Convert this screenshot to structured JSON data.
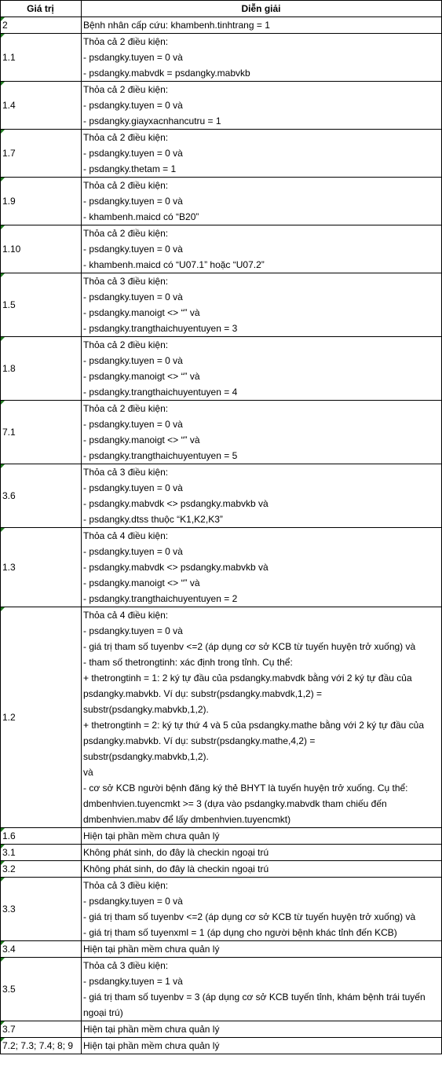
{
  "header": {
    "col1": "Giá trị",
    "col2": "Diễn giải"
  },
  "rows": [
    {
      "value": "2",
      "lines": [
        "Bệnh nhân cấp cứu: khambenh.tinhtrang = 1"
      ]
    },
    {
      "value": "1.1",
      "lines": [
        "Thỏa cả 2 điều kiện:",
        "- psdangky.tuyen = 0 và",
        "- psdangky.mabvdk = psdangky.mabvkb"
      ]
    },
    {
      "value": "1.4",
      "lines": [
        "Thỏa cả 2 điều kiện:",
        "- psdangky.tuyen = 0 và",
        "- psdangky.giayxacnhancutru = 1"
      ]
    },
    {
      "value": "1.7",
      "lines": [
        "Thỏa cả 2 điều kiện:",
        "- psdangky.tuyen = 0 và",
        "- psdangky.thetam = 1"
      ]
    },
    {
      "value": "1.9",
      "lines": [
        "Thỏa cả 2 điều kiện:",
        "- psdangky.tuyen = 0 và",
        "- khambenh.maicd có “B20”"
      ]
    },
    {
      "value": "1.10",
      "lines": [
        "Thỏa cả 2 điều kiện:",
        "- psdangky.tuyen = 0 và",
        "- khambenh.maicd có “U07.1” hoặc “U07.2”"
      ]
    },
    {
      "value": "1.5",
      "lines": [
        "Thỏa cả 3 điều kiện:",
        "- psdangky.tuyen = 0 và",
        "- psdangky.manoigt <> “” và",
        "- psdangky.trangthaichuyentuyen = 3"
      ]
    },
    {
      "value": "1.8",
      "lines": [
        "Thỏa cả 2 điều kiện:",
        "- psdangky.tuyen = 0 và",
        "- psdangky.manoigt <> “” và",
        "- psdangky.trangthaichuyentuyen = 4"
      ]
    },
    {
      "value": "7.1",
      "lines": [
        "Thỏa cả 2 điều kiện:",
        "- psdangky.tuyen = 0 và",
        "- psdangky.manoigt <> “” và",
        "- psdangky.trangthaichuyentuyen = 5"
      ]
    },
    {
      "value": "3.6",
      "lines": [
        "Thỏa cả 3 điều kiện:",
        "- psdangky.tuyen = 0 và",
        "- psdangky.mabvdk <> psdangky.mabvkb và",
        "- psdangky.dtss thuộc “K1,K2,K3”"
      ]
    },
    {
      "value": "1.3",
      "lines": [
        "Thỏa cả 4 điều kiện:",
        "- psdangky.tuyen = 0 và",
        "- psdangky.mabvdk <> psdangky.mabvkb và",
        "- psdangky.manoigt <> “” và",
        "- psdangky.trangthaichuyentuyen = 2"
      ]
    },
    {
      "value": "1.2",
      "lines": [
        "Thỏa cả 4 điều kiện:",
        "- psdangky.tuyen = 0 và",
        "- giá trị tham số tuyenbv <=2 (áp dụng cơ sở KCB từ tuyến huyện trở xuống) và",
        "- tham số thetrongtinh: xác định trong tỉnh. Cụ thể:",
        "+ thetrongtinh = 1: 2 ký tự đầu của  psdangky.mabvdk bằng với 2 ký tự đầu của psdangky.mabvkb. Ví dụ: substr(psdangky.mabvdk,1,2) = substr(psdangky.mabvkb,1,2).",
        "+ thetrongtinh = 2: ký tự thứ 4 và 5 của psdangky.mathe bằng với 2 ký tự đầu của  psdangky.mabvkb. Ví dụ: substr(psdangky.mathe,4,2) = substr(psdangky.mabvkb,1,2).",
        "và",
        "- cơ sở KCB người bệnh đăng ký thẻ BHYT là tuyến huyện trở xuống. Cụ thể: dmbenhvien.tuyencmkt >= 3 (dựa vào psdangky.mabvdk tham chiếu đến dmbenhvien.mabv để lấy dmbenhvien.tuyencmkt)"
      ]
    },
    {
      "value": "1.6",
      "lines": [
        "Hiện tại phần mềm chưa quản lý"
      ]
    },
    {
      "value": "3.1",
      "lines": [
        "Không phát sinh, do đây là checkin ngoại trú"
      ]
    },
    {
      "value": "3.2",
      "lines": [
        "Không phát sinh, do đây là checkin ngoại trú"
      ]
    },
    {
      "value": "3.3",
      "lines": [
        "Thỏa cả 3 điều kiện:",
        "- psdangky.tuyen = 0 và",
        "- giá trị tham số tuyenbv <=2 (áp dụng cơ sở KCB từ tuyến huyện trở xuống) và",
        "- giá trị tham số tuyenxml = 1 (áp dụng cho người bệnh khác tỉnh đến KCB)"
      ]
    },
    {
      "value": "3.4",
      "lines": [
        "Hiện tại phần mềm chưa quản lý"
      ]
    },
    {
      "value": "3.5",
      "lines": [
        "Thỏa cả 3 điều kiện:",
        "- psdangky.tuyen = 1 và",
        "- giá trị tham số tuyenbv = 3 (áp dụng cơ sở KCB  tuyến tỉnh, khám bệnh trái tuyến ngoại trú)"
      ]
    },
    {
      "value": "3.7",
      "lines": [
        "Hiện tại phần mềm chưa quản lý"
      ]
    },
    {
      "value": "7.2; 7.3; 7.4; 8; 9",
      "lines": [
        "Hiện tại phần mềm chưa quản lý"
      ]
    }
  ]
}
